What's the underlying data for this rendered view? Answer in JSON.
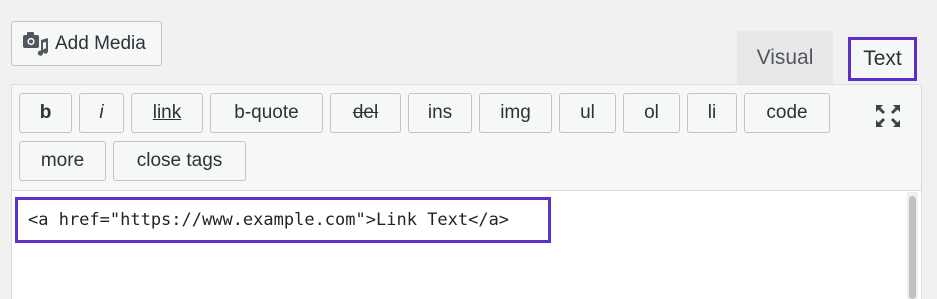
{
  "media": {
    "add_media_label": "Add Media",
    "icon": "media-icon"
  },
  "tabs": {
    "visual": "Visual",
    "text": "Text"
  },
  "quicktags": {
    "row1": [
      "b",
      "i",
      "link",
      "b-quote",
      "del",
      "ins",
      "img",
      "ul",
      "ol",
      "li",
      "code"
    ],
    "row2": [
      "more",
      "close tags"
    ]
  },
  "toolbar": {
    "fullscreen_icon": "fullscreen-icon"
  },
  "editor": {
    "content": "<a href=\"https://www.example.com\">Link Text</a>"
  },
  "colors": {
    "highlight": "#5b2fc9",
    "button_bg": "#f6f7f7",
    "border": "#c3c4c7"
  }
}
